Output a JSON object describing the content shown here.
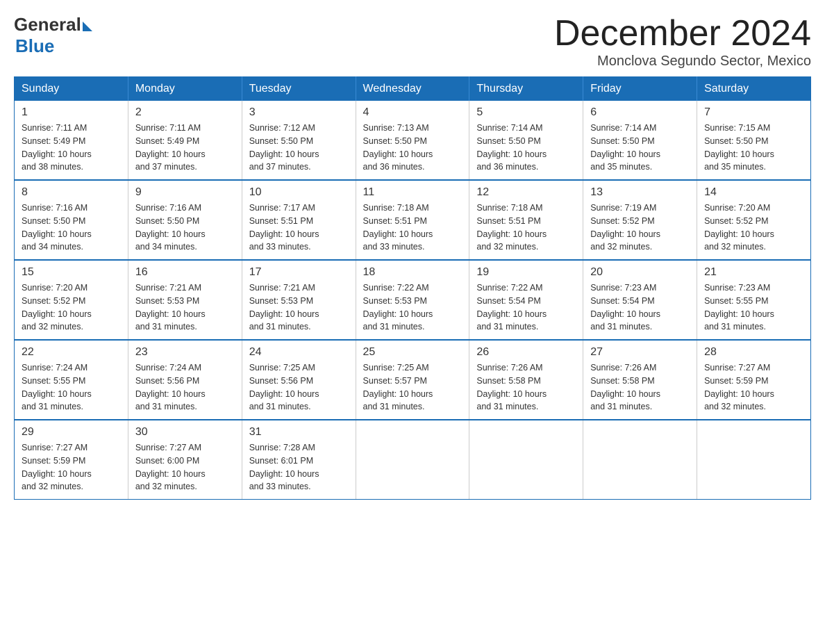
{
  "header": {
    "logo_general": "General",
    "logo_blue": "Blue",
    "month_title": "December 2024",
    "location": "Monclova Segundo Sector, Mexico"
  },
  "weekdays": [
    "Sunday",
    "Monday",
    "Tuesday",
    "Wednesday",
    "Thursday",
    "Friday",
    "Saturday"
  ],
  "weeks": [
    [
      {
        "day": "1",
        "sunrise": "7:11 AM",
        "sunset": "5:49 PM",
        "daylight": "10 hours and 38 minutes."
      },
      {
        "day": "2",
        "sunrise": "7:11 AM",
        "sunset": "5:49 PM",
        "daylight": "10 hours and 37 minutes."
      },
      {
        "day": "3",
        "sunrise": "7:12 AM",
        "sunset": "5:50 PM",
        "daylight": "10 hours and 37 minutes."
      },
      {
        "day": "4",
        "sunrise": "7:13 AM",
        "sunset": "5:50 PM",
        "daylight": "10 hours and 36 minutes."
      },
      {
        "day": "5",
        "sunrise": "7:14 AM",
        "sunset": "5:50 PM",
        "daylight": "10 hours and 36 minutes."
      },
      {
        "day": "6",
        "sunrise": "7:14 AM",
        "sunset": "5:50 PM",
        "daylight": "10 hours and 35 minutes."
      },
      {
        "day": "7",
        "sunrise": "7:15 AM",
        "sunset": "5:50 PM",
        "daylight": "10 hours and 35 minutes."
      }
    ],
    [
      {
        "day": "8",
        "sunrise": "7:16 AM",
        "sunset": "5:50 PM",
        "daylight": "10 hours and 34 minutes."
      },
      {
        "day": "9",
        "sunrise": "7:16 AM",
        "sunset": "5:50 PM",
        "daylight": "10 hours and 34 minutes."
      },
      {
        "day": "10",
        "sunrise": "7:17 AM",
        "sunset": "5:51 PM",
        "daylight": "10 hours and 33 minutes."
      },
      {
        "day": "11",
        "sunrise": "7:18 AM",
        "sunset": "5:51 PM",
        "daylight": "10 hours and 33 minutes."
      },
      {
        "day": "12",
        "sunrise": "7:18 AM",
        "sunset": "5:51 PM",
        "daylight": "10 hours and 32 minutes."
      },
      {
        "day": "13",
        "sunrise": "7:19 AM",
        "sunset": "5:52 PM",
        "daylight": "10 hours and 32 minutes."
      },
      {
        "day": "14",
        "sunrise": "7:20 AM",
        "sunset": "5:52 PM",
        "daylight": "10 hours and 32 minutes."
      }
    ],
    [
      {
        "day": "15",
        "sunrise": "7:20 AM",
        "sunset": "5:52 PM",
        "daylight": "10 hours and 32 minutes."
      },
      {
        "day": "16",
        "sunrise": "7:21 AM",
        "sunset": "5:53 PM",
        "daylight": "10 hours and 31 minutes."
      },
      {
        "day": "17",
        "sunrise": "7:21 AM",
        "sunset": "5:53 PM",
        "daylight": "10 hours and 31 minutes."
      },
      {
        "day": "18",
        "sunrise": "7:22 AM",
        "sunset": "5:53 PM",
        "daylight": "10 hours and 31 minutes."
      },
      {
        "day": "19",
        "sunrise": "7:22 AM",
        "sunset": "5:54 PM",
        "daylight": "10 hours and 31 minutes."
      },
      {
        "day": "20",
        "sunrise": "7:23 AM",
        "sunset": "5:54 PM",
        "daylight": "10 hours and 31 minutes."
      },
      {
        "day": "21",
        "sunrise": "7:23 AM",
        "sunset": "5:55 PM",
        "daylight": "10 hours and 31 minutes."
      }
    ],
    [
      {
        "day": "22",
        "sunrise": "7:24 AM",
        "sunset": "5:55 PM",
        "daylight": "10 hours and 31 minutes."
      },
      {
        "day": "23",
        "sunrise": "7:24 AM",
        "sunset": "5:56 PM",
        "daylight": "10 hours and 31 minutes."
      },
      {
        "day": "24",
        "sunrise": "7:25 AM",
        "sunset": "5:56 PM",
        "daylight": "10 hours and 31 minutes."
      },
      {
        "day": "25",
        "sunrise": "7:25 AM",
        "sunset": "5:57 PM",
        "daylight": "10 hours and 31 minutes."
      },
      {
        "day": "26",
        "sunrise": "7:26 AM",
        "sunset": "5:58 PM",
        "daylight": "10 hours and 31 minutes."
      },
      {
        "day": "27",
        "sunrise": "7:26 AM",
        "sunset": "5:58 PM",
        "daylight": "10 hours and 31 minutes."
      },
      {
        "day": "28",
        "sunrise": "7:27 AM",
        "sunset": "5:59 PM",
        "daylight": "10 hours and 32 minutes."
      }
    ],
    [
      {
        "day": "29",
        "sunrise": "7:27 AM",
        "sunset": "5:59 PM",
        "daylight": "10 hours and 32 minutes."
      },
      {
        "day": "30",
        "sunrise": "7:27 AM",
        "sunset": "6:00 PM",
        "daylight": "10 hours and 32 minutes."
      },
      {
        "day": "31",
        "sunrise": "7:28 AM",
        "sunset": "6:01 PM",
        "daylight": "10 hours and 33 minutes."
      },
      null,
      null,
      null,
      null
    ]
  ],
  "labels": {
    "sunrise": "Sunrise:",
    "sunset": "Sunset:",
    "daylight": "Daylight:"
  }
}
